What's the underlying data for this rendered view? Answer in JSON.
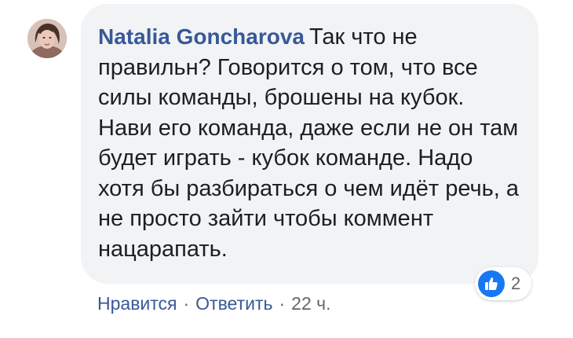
{
  "comment": {
    "author": "Natalia Goncharova",
    "text": "Так что не правильн? Говорится о том, что все силы команды, брошены на кубок. Нави его команда, даже если не он там будет играть - кубок команде. Надо хотя бы разбираться о чем идёт речь, а не просто зайти чтобы коммент нацарапать."
  },
  "reactions": {
    "icon": "like-icon",
    "count": "2",
    "color": "#1877f2"
  },
  "actions": {
    "like_label": "Нравится",
    "reply_label": "Ответить",
    "separator": "·",
    "timestamp": "22 ч."
  },
  "colors": {
    "author": "#385898",
    "bubble": "#f2f3f5",
    "text": "#1c1e21",
    "meta": "#606770"
  }
}
